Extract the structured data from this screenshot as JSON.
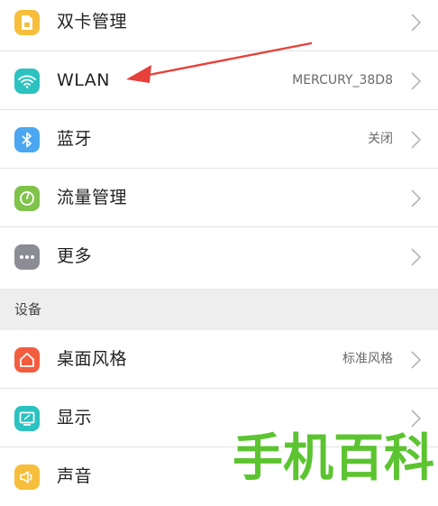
{
  "network": {
    "items": [
      {
        "label": "双卡管理",
        "value": "",
        "icon": "sim-card-icon",
        "color": "#f6be3a"
      },
      {
        "label": "WLAN",
        "value": "MERCURY_38D8",
        "icon": "wifi-icon",
        "color": "#2bc2c0"
      },
      {
        "label": "蓝牙",
        "value": "关闭",
        "icon": "bluetooth-icon",
        "color": "#4aa7f0"
      },
      {
        "label": "流量管理",
        "value": "",
        "icon": "data-usage-icon",
        "color": "#7fc34a"
      },
      {
        "label": "更多",
        "value": "",
        "icon": "more-icon",
        "color": "#8c8c95"
      }
    ]
  },
  "device": {
    "section_title": "设备",
    "items": [
      {
        "label": "桌面风格",
        "value": "标准风格",
        "icon": "home-style-icon",
        "color": "#f25d3f"
      },
      {
        "label": "显示",
        "value": "",
        "icon": "display-icon",
        "color": "#2bc2c0"
      },
      {
        "label": "声音",
        "value": "",
        "icon": "sound-icon",
        "color": "#f6be3a"
      }
    ]
  },
  "annotation": {
    "arrow_color": "#e8403a"
  },
  "watermark": {
    "text": "手机百科",
    "color": "#4ec01f"
  }
}
